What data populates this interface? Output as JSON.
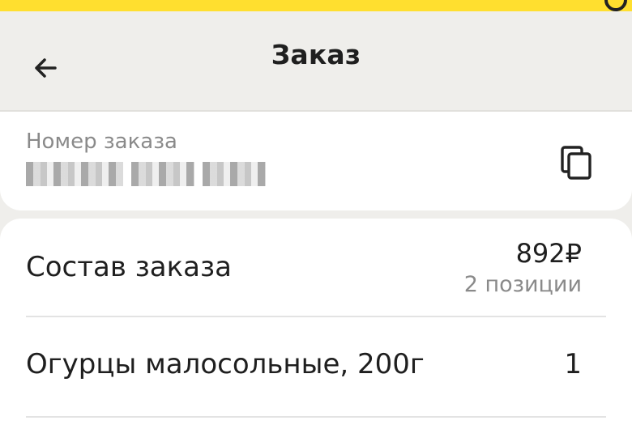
{
  "header": {
    "title": "Заказ",
    "back_icon": "arrow-left-icon"
  },
  "order_number": {
    "label": "Номер заказа",
    "value_state": "blurred",
    "copy_icon": "copy-icon"
  },
  "order_content": {
    "title": "Состав заказа",
    "total": "892₽",
    "positions": "2 позиции",
    "items": [
      {
        "name": "Огурцы малосольные, 200г",
        "quantity": "1"
      }
    ]
  },
  "colors": {
    "status_bar": "#ffdf2f",
    "background": "#efeeeb",
    "card": "#ffffff",
    "secondary_text": "#8a8a8a"
  }
}
